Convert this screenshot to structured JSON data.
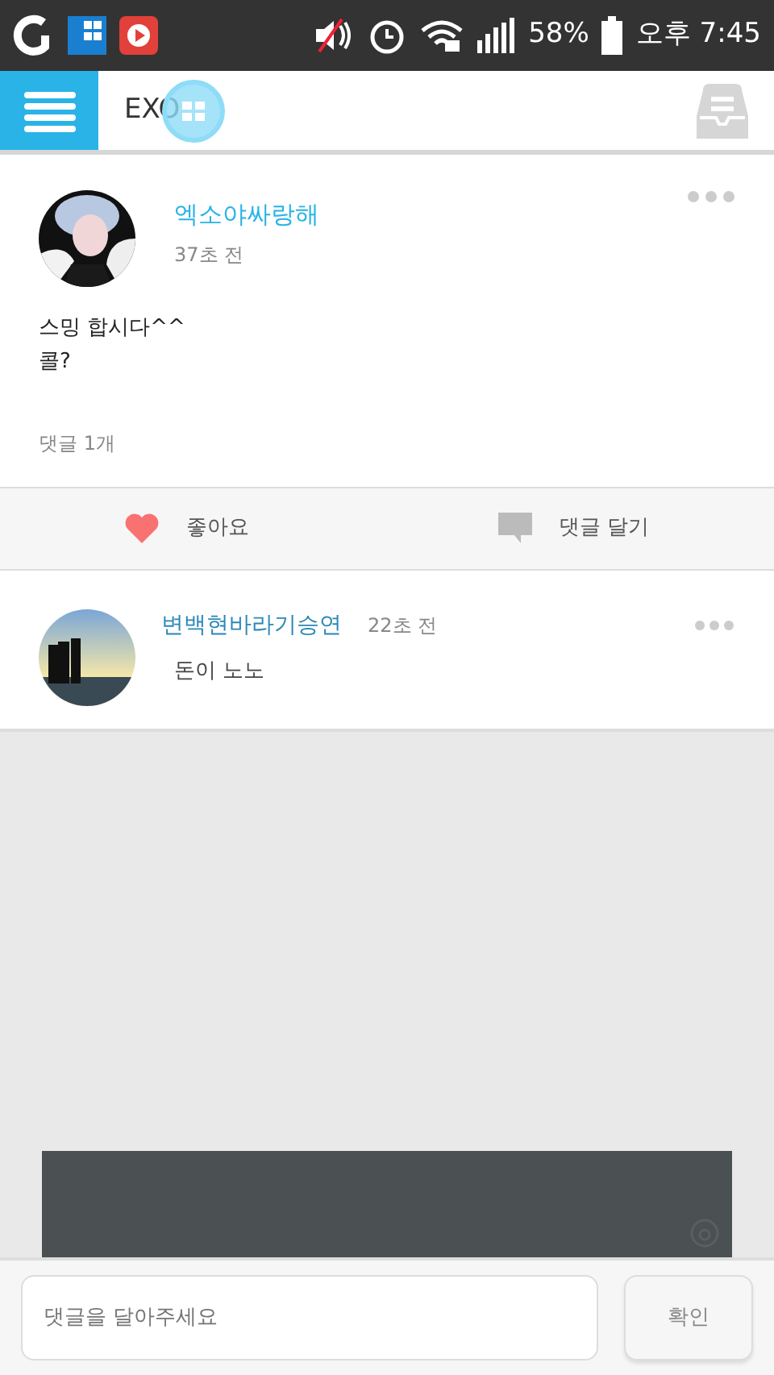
{
  "status_bar": {
    "battery": "58%",
    "time": "오후 7:45"
  },
  "header": {
    "title": "EXO"
  },
  "post": {
    "author": "엑소야싸랑해",
    "time": "37초 전",
    "body": [
      "스밍 합시다^^",
      "콜?"
    ],
    "comment_count": "댓글 1개"
  },
  "actions": [
    {
      "kind": "like",
      "label": "좋아요"
    },
    {
      "kind": "comment",
      "label": "댓글 달기"
    }
  ],
  "comments": [
    {
      "author": "변백현바라기승연",
      "time": "22초 전",
      "text": "돈이 노노"
    }
  ],
  "composer": {
    "placeholder": "댓글을 달아주세요",
    "button": "확인"
  }
}
